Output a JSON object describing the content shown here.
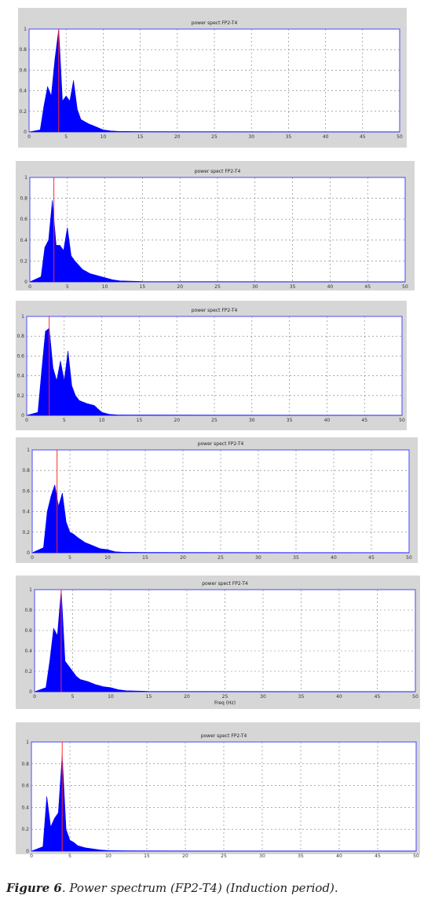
{
  "caption": {
    "label": "Figure 6",
    "text": ". Power spectrum (FP2-T4) (Induction period)."
  },
  "colors": {
    "spectrum": "#0000ff",
    "peak_marker": "#ff2a2a",
    "plot_border": "#4a4aff",
    "frame": "#d6d6d6"
  },
  "chart_data": [
    {
      "type": "area",
      "title": "power spect FP2-T4",
      "xlabel": "",
      "ylabel": "",
      "xlim": [
        0,
        50
      ],
      "ylim": [
        0,
        1
      ],
      "xticks": [
        0,
        5,
        10,
        15,
        20,
        25,
        30,
        35,
        40,
        45,
        50
      ],
      "yticks": [
        0,
        0.2,
        0.4,
        0.6,
        0.8,
        1
      ],
      "grid": true,
      "peak_marker_x": 4.0,
      "series": [
        {
          "x": [
            0,
            1.5,
            2,
            2.5,
            3,
            3.5,
            4,
            4.5,
            5,
            5.5,
            6,
            6.5,
            7,
            8,
            9,
            10,
            11,
            12,
            15,
            50
          ],
          "values": [
            0,
            0.02,
            0.25,
            0.44,
            0.35,
            0.71,
            1.0,
            0.3,
            0.35,
            0.3,
            0.5,
            0.22,
            0.12,
            0.08,
            0.05,
            0.02,
            0.01,
            0.005,
            0.003,
            0
          ]
        }
      ]
    },
    {
      "type": "area",
      "title": "power spect FP2-T4",
      "xlabel": "",
      "ylabel": "",
      "xlim": [
        0,
        50
      ],
      "ylim": [
        0,
        1
      ],
      "xticks": [
        0,
        5,
        10,
        15,
        20,
        25,
        30,
        35,
        40,
        45,
        50
      ],
      "yticks": [
        0,
        0.2,
        0.4,
        0.6,
        0.8,
        1
      ],
      "grid": true,
      "peak_marker_x": 3.2,
      "series": [
        {
          "x": [
            0,
            1.5,
            2,
            2.5,
            3,
            3.5,
            4,
            4.5,
            5,
            5.5,
            6,
            7,
            8,
            9,
            10,
            11,
            12,
            15,
            50
          ],
          "values": [
            0,
            0.05,
            0.33,
            0.4,
            0.78,
            0.35,
            0.35,
            0.3,
            0.52,
            0.25,
            0.2,
            0.12,
            0.08,
            0.06,
            0.04,
            0.02,
            0.01,
            0.003,
            0
          ]
        }
      ]
    },
    {
      "type": "area",
      "title": "power spect FP2-T4",
      "xlabel": "",
      "ylabel": "",
      "xlim": [
        0,
        50
      ],
      "ylim": [
        0,
        1
      ],
      "xticks": [
        0,
        5,
        10,
        15,
        20,
        25,
        30,
        35,
        40,
        45,
        50
      ],
      "yticks": [
        0,
        0.2,
        0.4,
        0.6,
        0.8,
        1
      ],
      "grid": true,
      "peak_marker_x": 3.0,
      "series": [
        {
          "x": [
            0,
            1.5,
            2,
            2.5,
            3,
            3.5,
            4,
            4.5,
            5,
            5.5,
            6,
            6.5,
            7,
            8,
            9,
            10,
            11,
            12,
            15,
            50
          ],
          "values": [
            0,
            0.03,
            0.45,
            0.85,
            0.88,
            0.48,
            0.35,
            0.55,
            0.35,
            0.65,
            0.3,
            0.2,
            0.15,
            0.12,
            0.1,
            0.03,
            0.01,
            0.005,
            0.003,
            0
          ]
        }
      ]
    },
    {
      "type": "area",
      "title": "power spect FP2-T4",
      "xlabel": "",
      "ylabel": "",
      "xlim": [
        0,
        50
      ],
      "ylim": [
        0,
        1
      ],
      "xticks": [
        0,
        5,
        10,
        15,
        20,
        25,
        30,
        35,
        40,
        45,
        50
      ],
      "yticks": [
        0,
        0.2,
        0.4,
        0.6,
        0.8,
        1
      ],
      "grid": true,
      "peak_marker_x": 3.3,
      "series": [
        {
          "x": [
            0,
            1.5,
            2,
            2.5,
            3,
            3.5,
            4,
            4.5,
            5,
            5.5,
            6,
            7,
            8,
            9,
            10,
            11,
            12,
            15,
            50
          ],
          "values": [
            0,
            0.05,
            0.4,
            0.55,
            0.66,
            0.45,
            0.58,
            0.3,
            0.2,
            0.18,
            0.15,
            0.1,
            0.07,
            0.04,
            0.03,
            0.01,
            0.005,
            0.003,
            0
          ]
        }
      ]
    },
    {
      "type": "area",
      "title": "power spect FP2-T4",
      "xlabel": "Freq (Hz)",
      "ylabel": "",
      "xlim": [
        0,
        50
      ],
      "ylim": [
        0,
        1
      ],
      "xticks": [
        0,
        5,
        10,
        15,
        20,
        25,
        30,
        35,
        40,
        45,
        50
      ],
      "yticks": [
        0,
        0.2,
        0.4,
        0.6,
        0.8,
        1
      ],
      "grid": true,
      "peak_marker_x": 3.5,
      "series": [
        {
          "x": [
            0,
            1.5,
            2,
            2.5,
            3,
            3.5,
            4,
            4.5,
            5,
            5.5,
            6,
            7,
            8,
            9,
            10,
            11,
            12,
            15,
            50
          ],
          "values": [
            0,
            0.04,
            0.3,
            0.62,
            0.55,
            1.0,
            0.3,
            0.25,
            0.2,
            0.15,
            0.12,
            0.1,
            0.07,
            0.05,
            0.04,
            0.02,
            0.01,
            0.003,
            0
          ]
        }
      ]
    },
    {
      "type": "area",
      "title": "power spect FP2-T4",
      "xlabel": "",
      "ylabel": "",
      "xlim": [
        0,
        50
      ],
      "ylim": [
        0,
        1
      ],
      "xticks": [
        0,
        5,
        10,
        15,
        20,
        25,
        30,
        35,
        40,
        45,
        50
      ],
      "yticks": [
        0,
        0.2,
        0.4,
        0.6,
        0.8,
        1
      ],
      "grid": true,
      "peak_marker_x": 4.0,
      "series": [
        {
          "x": [
            0,
            1.5,
            2,
            2.5,
            3,
            3.5,
            4,
            4.5,
            5,
            5.5,
            6,
            7,
            8,
            9,
            10,
            12,
            15,
            50
          ],
          "values": [
            0,
            0.04,
            0.5,
            0.22,
            0.3,
            0.35,
            0.88,
            0.2,
            0.1,
            0.08,
            0.05,
            0.03,
            0.02,
            0.01,
            0.005,
            0.003,
            0.002,
            0
          ]
        }
      ]
    }
  ]
}
